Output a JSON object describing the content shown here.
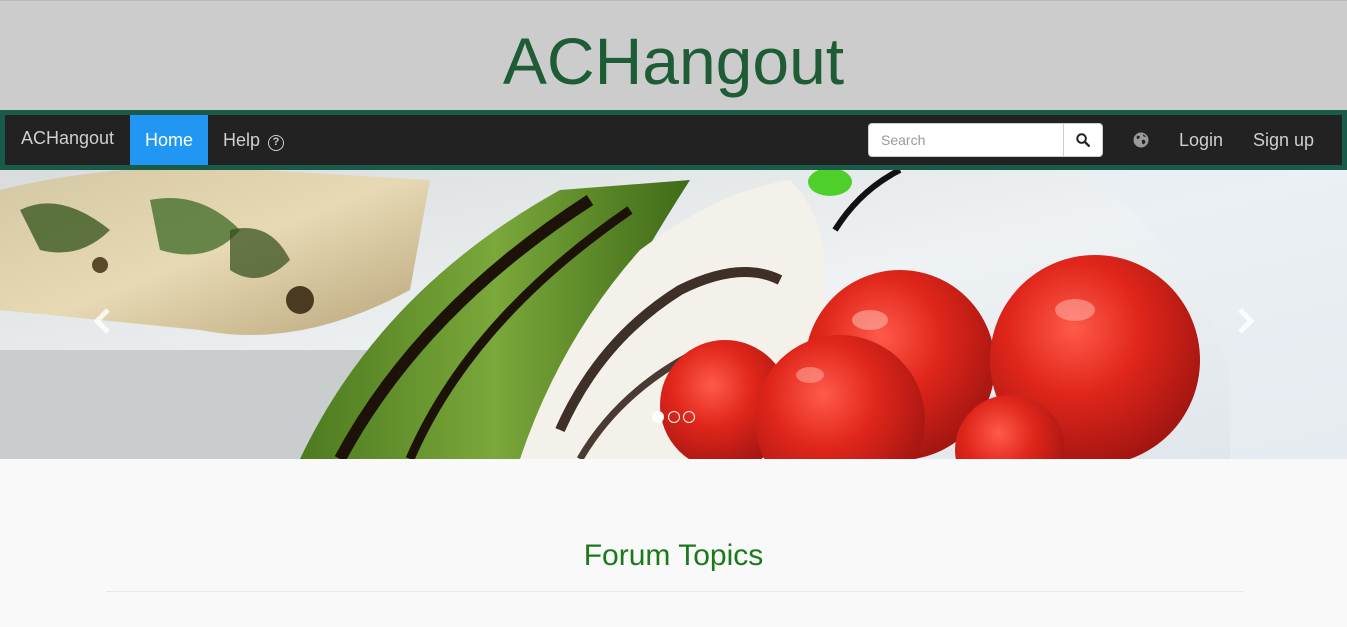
{
  "header": {
    "title": "ACHangout"
  },
  "navbar": {
    "brand": "ACHangout",
    "items": [
      {
        "label": "Home",
        "active": true
      },
      {
        "label": "Help"
      }
    ],
    "help_icon": "question-circle-icon",
    "search": {
      "placeholder": "Search",
      "value": "",
      "button_icon": "search-icon"
    },
    "language_icon": "globe-icon",
    "login_label": "Login",
    "signup_label": "Sign up",
    "active_color": "#2196f3",
    "border_color": "#1a5a4a"
  },
  "carousel": {
    "slide_count": 3,
    "active_index": 0,
    "prev_icon": "chevron-left-icon",
    "next_icon": "chevron-right-icon"
  },
  "main": {
    "section_title": "Forum Topics",
    "title_color": "#1a7a1a"
  }
}
